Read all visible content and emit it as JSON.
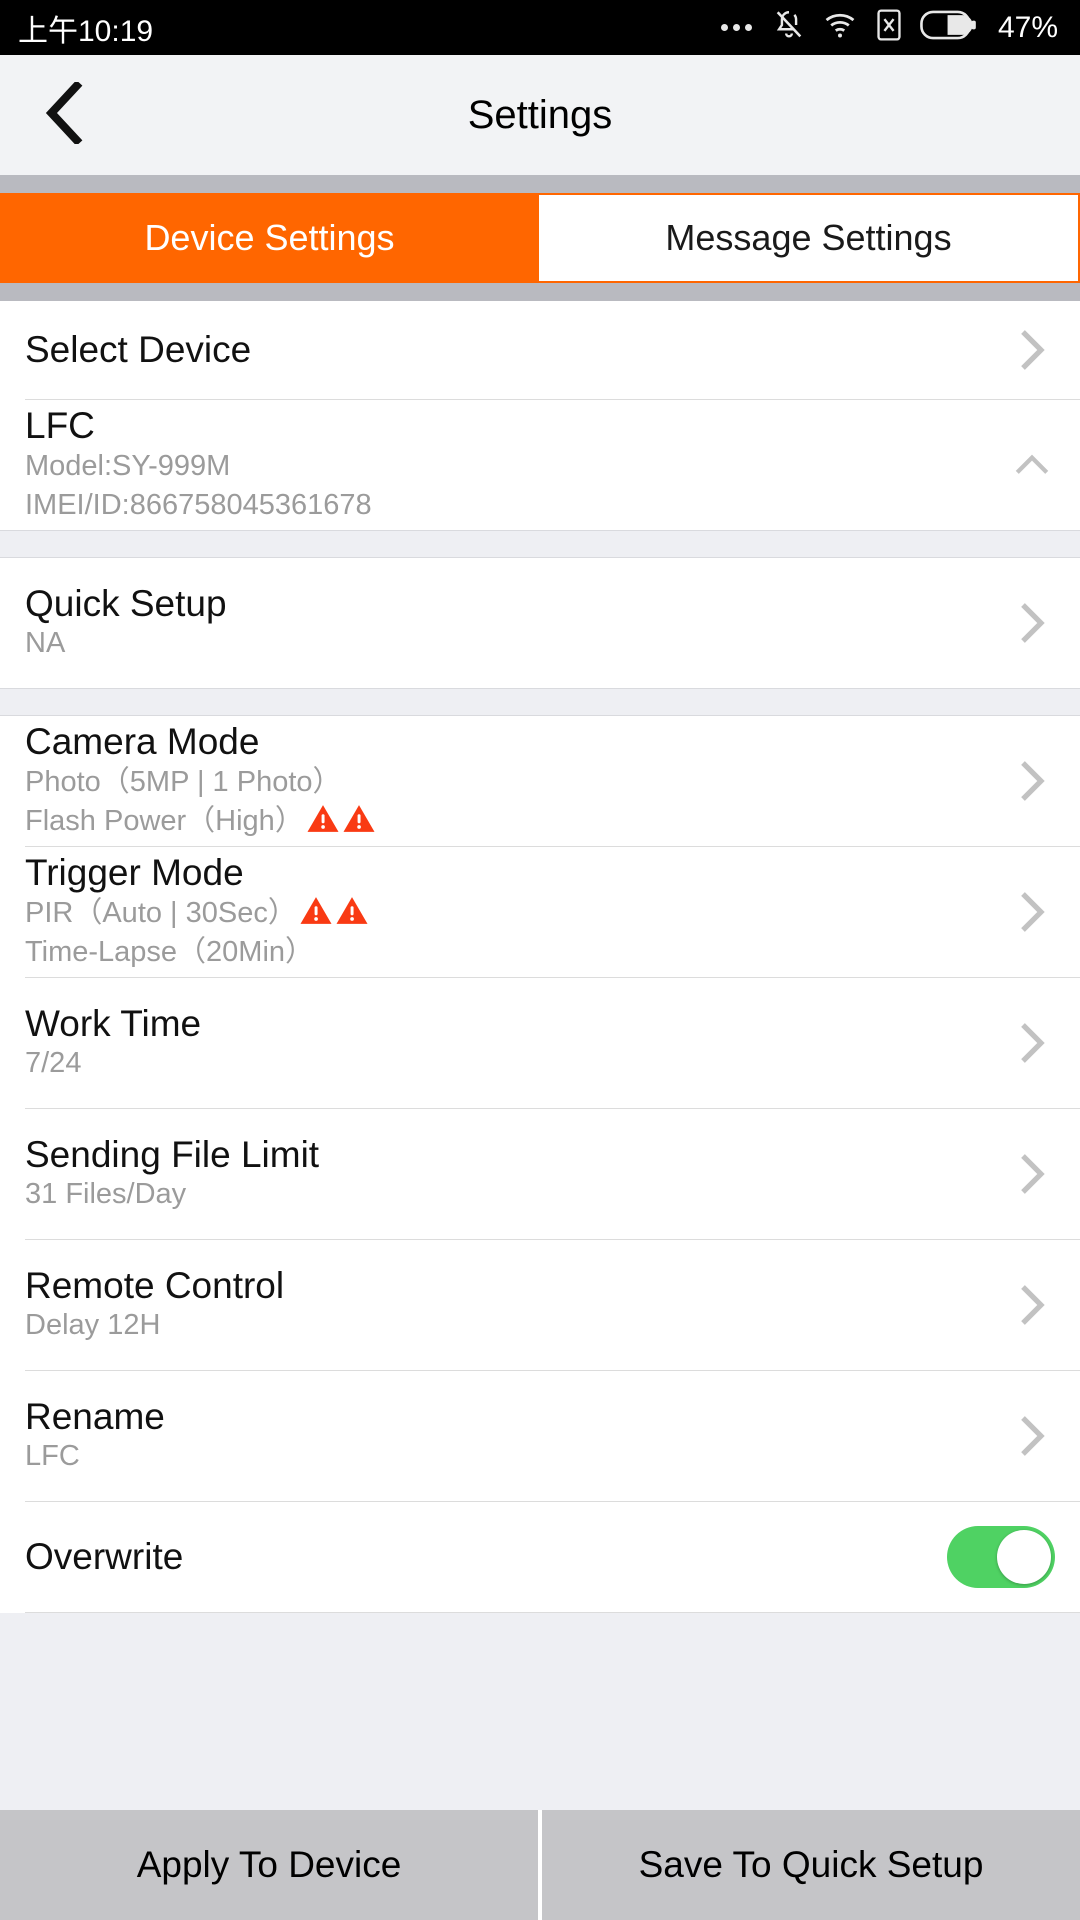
{
  "status_bar": {
    "time": "上午10:19",
    "battery_percent": "47%",
    "icons": [
      "more-dots-icon",
      "bell-off-icon",
      "wifi-icon",
      "sim-x-icon",
      "battery-icon"
    ]
  },
  "header": {
    "title": "Settings",
    "back_icon": "back-chevron-icon"
  },
  "tabs": [
    {
      "label": "Device Settings",
      "active": true
    },
    {
      "label": "Message Settings",
      "active": false
    }
  ],
  "colors": {
    "accent_orange": "#ff6600",
    "warning_red": "#f93a13",
    "toggle_green": "#4fd263",
    "bottom_button_gray": "#c5c5c8"
  },
  "list": {
    "select_device": {
      "label": "Select Device"
    },
    "device": {
      "name": "LFC",
      "model": "Model:SY-999M",
      "imei": "IMEI/ID:866758045361678",
      "collapse_icon": "chevron-up-icon"
    },
    "quick_setup": {
      "label": "Quick Setup",
      "value": "NA"
    },
    "camera_mode": {
      "label": "Camera Mode",
      "line1": "Photo（5MP | 1 Photo）",
      "line2": "Flash Power（High）",
      "warnings": 2
    },
    "trigger_mode": {
      "label": "Trigger Mode",
      "line1": "PIR（Auto | 30Sec）",
      "line2": "Time-Lapse（20Min）",
      "warnings": 2
    },
    "work_time": {
      "label": "Work Time",
      "value": "7/24"
    },
    "sending_file_limit": {
      "label": "Sending File Limit",
      "value": "31 Files/Day"
    },
    "remote_control": {
      "label": "Remote Control",
      "value": "Delay 12H"
    },
    "rename": {
      "label": "Rename",
      "value": "LFC"
    },
    "overwrite": {
      "label": "Overwrite",
      "state": "on"
    }
  },
  "bottom_bar": {
    "apply_label": "Apply To Device",
    "save_label": "Save To Quick Setup"
  }
}
